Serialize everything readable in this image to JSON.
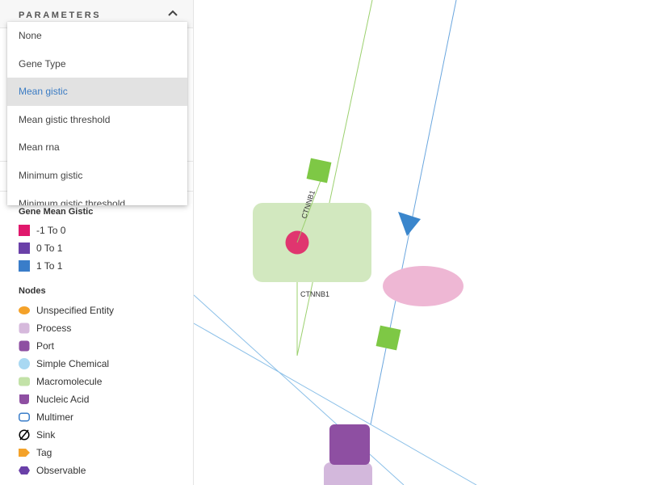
{
  "sidebar": {
    "parameters_title": "PARAMETERS",
    "dropdown": {
      "items": [
        "None",
        "Gene Type",
        "Mean gistic",
        "Mean gistic threshold",
        "Mean rna",
        "Minimum gistic",
        "Minimum gistic threshold"
      ],
      "selected": "Mean gistic"
    },
    "gene_legend": {
      "title": "Gene Mean Gistic",
      "items": [
        {
          "label": "-1 To 0",
          "color": "#e0186c"
        },
        {
          "label": "0 To 1",
          "color": "#6a40a8"
        },
        {
          "label": "1 To 1",
          "color": "#3a7dc9"
        }
      ]
    },
    "nodes_legend": {
      "title": "Nodes",
      "items": [
        {
          "label": "Unspecified Entity",
          "icon": "ellipse-icon",
          "color": "#f4a22a"
        },
        {
          "label": "Process",
          "icon": "rounded-square-icon",
          "color": "#d6b9dc"
        },
        {
          "label": "Port",
          "icon": "rounded-square-icon",
          "color": "#8e4fa2"
        },
        {
          "label": "Simple Chemical",
          "icon": "circle-icon",
          "color": "#a9d8f2"
        },
        {
          "label": "Macromolecule",
          "icon": "rounded-rect-icon",
          "color": "#c3e2a8"
        },
        {
          "label": "Nucleic Acid",
          "icon": "nucleic-acid-icon",
          "color": "#8e4fa2"
        },
        {
          "label": "Multimer",
          "icon": "multimer-icon",
          "color": "#3a7dc9"
        },
        {
          "label": "Sink",
          "icon": "sink-icon",
          "color": "#000000"
        },
        {
          "label": "Tag",
          "icon": "tag-icon",
          "color": "#f4a22a"
        },
        {
          "label": "Observable",
          "icon": "hexagon-icon",
          "color": "#6a40a8"
        }
      ]
    }
  },
  "graph": {
    "macromolecule_label": "CTNNB1",
    "rotated_label": "CTNNB1",
    "colors": {
      "macromolecule": "#d2e8bf",
      "gene_dot": "#e0356f",
      "pink_ellipse": "#eeb7d4",
      "process_square": "#7ec845",
      "edge_green": "#88c85a",
      "edge_blue": "#5a9ad8",
      "arrow_blue": "#3a86cc",
      "port_purple": "#8e4fa2",
      "process_lavender": "#d3b8dc"
    }
  }
}
